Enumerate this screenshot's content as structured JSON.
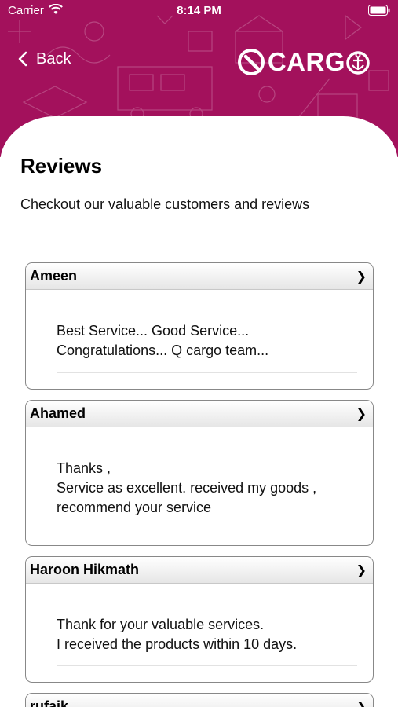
{
  "status_bar": {
    "carrier": "Carrier",
    "time": "8:14 PM"
  },
  "header": {
    "back_label": "Back",
    "logo_text": "CARG",
    "accent_color": "#a3115c"
  },
  "page": {
    "title": "Reviews",
    "subtitle": "Checkout our valuable customers and reviews"
  },
  "reviews": [
    {
      "name": "Ameen",
      "lines": [
        "Best Service... Good Service...",
        "Congratulations... Q cargo team..."
      ]
    },
    {
      "name": "Ahamed",
      "lines": [
        "Thanks ,",
        "Service as excellent. received my goods ,",
        "recommend your service"
      ]
    },
    {
      "name": "Haroon Hikmath",
      "lines": [
        "Thank for your valuable services.",
        "I received the products within 10 days."
      ]
    },
    {
      "name": "rufaik",
      "lines": []
    }
  ],
  "icons": {
    "expand": "chevron-right-icon",
    "back": "chevron-left-icon"
  }
}
